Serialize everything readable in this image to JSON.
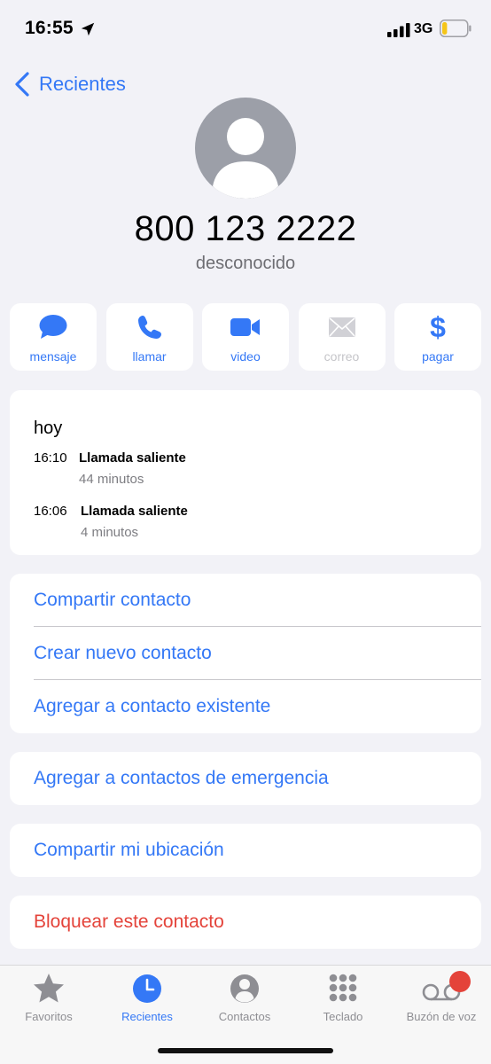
{
  "status_bar": {
    "time": "16:55",
    "network": "3G",
    "battery_level": 0.2
  },
  "nav": {
    "back_label": "Recientes"
  },
  "contact": {
    "number": "800 123 2222",
    "label": "desconocido"
  },
  "actions": [
    {
      "label": "mensaje",
      "icon": "message-bubble-icon",
      "enabled": true
    },
    {
      "label": "llamar",
      "icon": "phone-icon",
      "enabled": true
    },
    {
      "label": "video",
      "icon": "video-camera-icon",
      "enabled": true
    },
    {
      "label": "correo",
      "icon": "envelope-icon",
      "enabled": false
    },
    {
      "label": "pagar",
      "icon": "dollar-icon",
      "symbol": "$",
      "enabled": true
    }
  ],
  "calls": {
    "date": "hoy",
    "items": [
      {
        "time": "16:10",
        "type": "Llamada saliente",
        "duration": "44 minutos"
      },
      {
        "time": "16:06",
        "type": "Llamada saliente",
        "duration": "4 minutos"
      }
    ]
  },
  "options": {
    "share_contact": "Compartir contacto",
    "create_contact": "Crear nuevo contacto",
    "add_existing": "Agregar a contacto existente",
    "add_emergency": "Agregar a contactos de emergencia",
    "share_location": "Compartir mi ubicación",
    "block_contact": "Bloquear este contacto"
  },
  "tabs": [
    {
      "label": "Favoritos",
      "icon": "star-icon",
      "active": false
    },
    {
      "label": "Recientes",
      "icon": "clock-icon",
      "active": true
    },
    {
      "label": "Contactos",
      "icon": "person-circle-icon",
      "active": false
    },
    {
      "label": "Teclado",
      "icon": "keypad-icon",
      "active": false
    },
    {
      "label": "Buzón de voz",
      "icon": "voicemail-icon",
      "active": false,
      "badge": true
    }
  ],
  "colors": {
    "accent": "#3478f6",
    "destructive": "#e4433a",
    "background": "#f2f2f7",
    "battery_fill": "#f5c518"
  }
}
